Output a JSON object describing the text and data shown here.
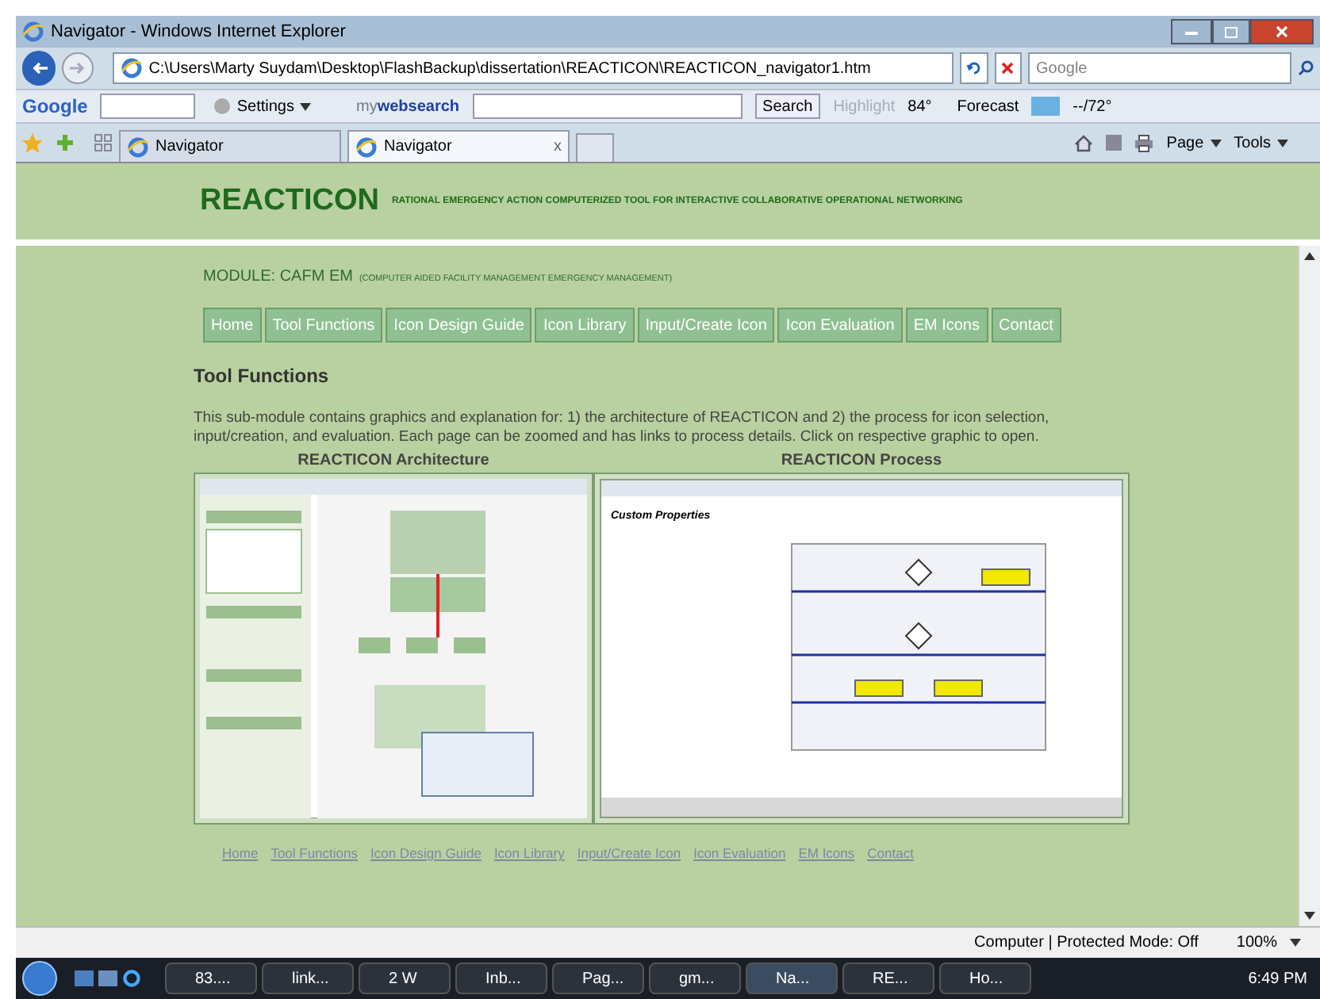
{
  "window": {
    "title": "Navigator - Windows Internet Explorer"
  },
  "address_bar": {
    "url": "C:\\Users\\Marty Suydam\\Desktop\\FlashBackup\\dissertation\\REACTICON\\REACTICON_navigator1.htm"
  },
  "search_box": {
    "placeholder": "Google"
  },
  "google_toolbar": {
    "logo": "Google",
    "settings": "Settings",
    "mywebsearch_prefix": "my",
    "mywebsearch_bold": "websearch",
    "search_button": "Search",
    "highlight": "Highlight",
    "temperature": "84°",
    "forecast": "Forecast",
    "forecast_temp": "--/72°"
  },
  "tabs": [
    {
      "label": "Navigator",
      "selected": false
    },
    {
      "label": "Navigator",
      "selected": true,
      "close": "x"
    }
  ],
  "command_bar": {
    "page": "Page",
    "tools": "Tools"
  },
  "page": {
    "logo": "REACTICON",
    "tagline": "RATIONAL EMERGENCY ACTION COMPUTERIZED TOOL FOR INTERACTIVE COLLABORATIVE OPERATIONAL NETWORKING",
    "module": "MODULE: CAFM EM",
    "module_note": "(COMPUTER AIDED FACILITY MANAGEMENT EMERGENCY MANAGEMENT)",
    "nav": [
      "Home",
      "Tool Functions",
      "Icon Design Guide",
      "Icon Library",
      "Input/Create Icon",
      "Icon Evaluation",
      "EM Icons",
      "Contact"
    ],
    "heading": "Tool Functions",
    "intro": "This sub-module contains graphics and explanation for: 1) the architecture of REACTICON and 2) the process for icon selection, input/creation, and evaluation.  Each page can be zoomed and has links to process details.  Click on respective graphic to open.",
    "graphics": [
      {
        "caption": "REACTICON Architecture",
        "kind": "architecture"
      },
      {
        "caption": "REACTICON Process",
        "kind": "process",
        "inner_title": "Custom Properties"
      }
    ],
    "footer_links": [
      "Home",
      "Tool Functions",
      "Icon Design Guide",
      "Icon Library",
      "Input/Create Icon",
      "Icon Evaluation",
      "EM Icons",
      "Contact"
    ]
  },
  "status_bar": {
    "zone": "Computer | Protected Mode: Off",
    "zoom": "100%"
  },
  "taskbar": {
    "items": [
      {
        "label": "83....",
        "selected": false
      },
      {
        "label": "link...",
        "selected": false
      },
      {
        "label": "2 W",
        "selected": false
      },
      {
        "label": "Inb...",
        "selected": false
      },
      {
        "label": "Pag...",
        "selected": false
      },
      {
        "label": "gm...",
        "selected": false
      },
      {
        "label": "Na...",
        "selected": true
      },
      {
        "label": "RE...",
        "selected": false
      },
      {
        "label": "Ho...",
        "selected": false
      }
    ],
    "clock": "6:49 PM"
  }
}
